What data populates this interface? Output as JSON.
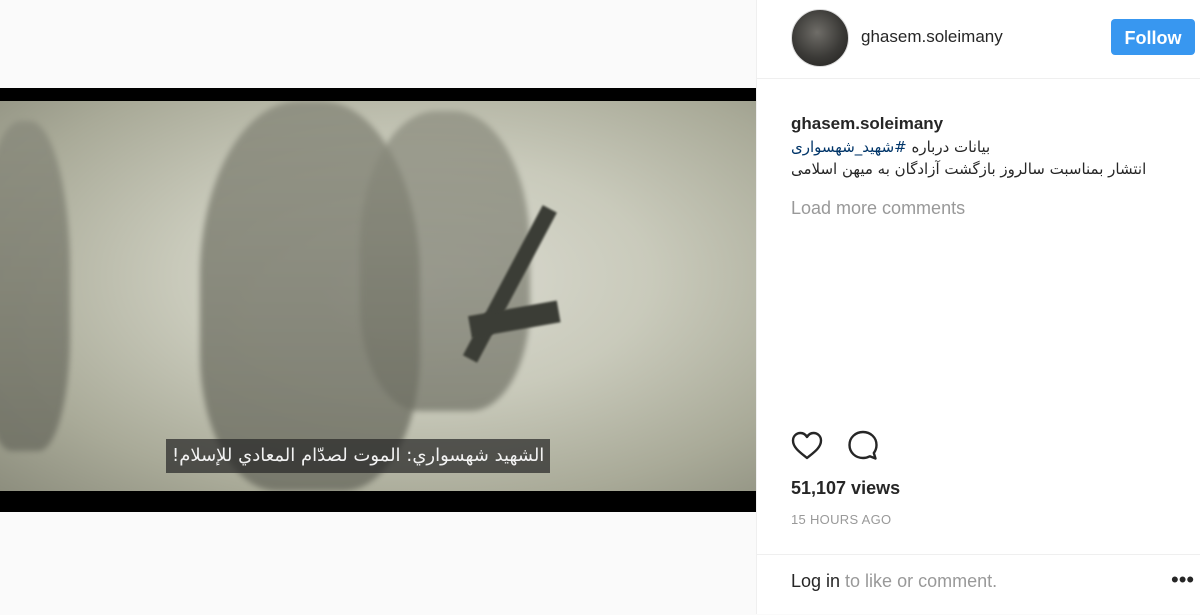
{
  "video": {
    "subtitle": "الشهيد شهسواري: الموت لصدّام المعادي للإسلام!"
  },
  "header": {
    "username": "ghasem.soleimany",
    "follow_label": "Follow"
  },
  "caption": {
    "username": "ghasem.soleimany",
    "line1_text": "بیانات درباره ",
    "line1_hashtag": "#شهید_شهسواری",
    "line2_text": "انتشار بمناسبت سالروز بازگشت آزادگان به میهن اسلامی"
  },
  "comments": {
    "load_more": "Load more comments"
  },
  "stats": {
    "views": "51,107 views",
    "timestamp": "15 HOURS AGO"
  },
  "footer": {
    "login_link": "Log in",
    "login_rest": " to like or comment.",
    "more_label": "•••"
  },
  "icons": {
    "like": "heart-icon",
    "comment": "comment-icon"
  },
  "colors": {
    "follow_button": "#3897f0",
    "hashtag": "#003569",
    "muted_text": "#999999"
  }
}
